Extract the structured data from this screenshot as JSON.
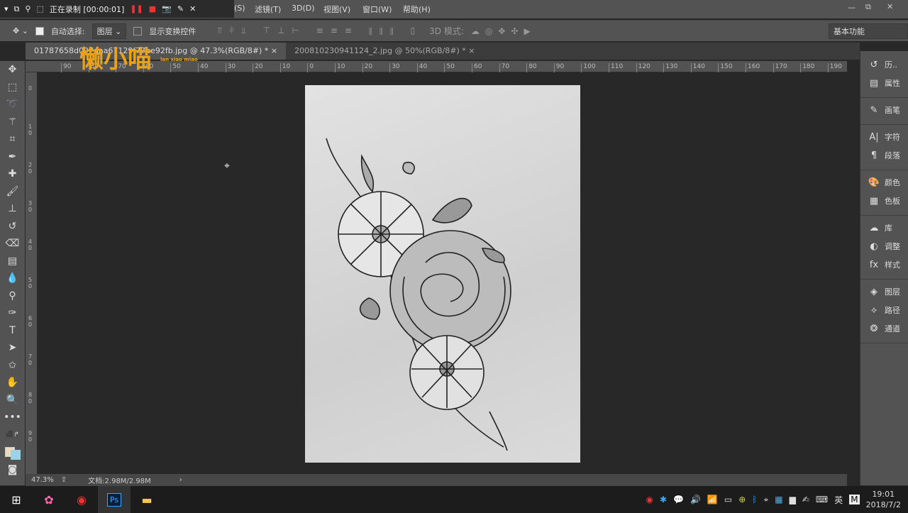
{
  "recorder": {
    "status": "正在录制 [00:00:01]"
  },
  "menus": [
    "(S)",
    "滤镜(T)",
    "3D(D)",
    "视图(V)",
    "窗口(W)",
    "帮助(H)"
  ],
  "options": {
    "auto_select_label": "自动选择:",
    "auto_select_checked": true,
    "layer_select": "图层",
    "show_transform_label": "显示变换控件",
    "show_transform_checked": false,
    "mode_3d_label": "3D 模式:",
    "workspace": "基本功能"
  },
  "tabs": [
    {
      "label": "01787658d097daa67129f77ee92fb.jpg @ 47.3%(RGB/8#) *",
      "active": true
    },
    {
      "label": "200810230941124_2.jpg @ 50%(RGB/8#) *",
      "active": false
    }
  ],
  "ruler_labels": [
    "90",
    "80",
    "70",
    "60",
    "50",
    "40",
    "30",
    "20",
    "10",
    "0",
    "10",
    "20",
    "30",
    "40",
    "50",
    "60",
    "70",
    "80",
    "90",
    "100",
    "110",
    "120",
    "130",
    "140",
    "150",
    "160",
    "170",
    "180",
    "190"
  ],
  "vruler_labels": [
    "0",
    "1 0",
    "2 0",
    "3 0",
    "4 0",
    "5 0",
    "6 0",
    "7 0",
    "8 0",
    "9 0"
  ],
  "watermark": {
    "text": "懒小喵",
    "sub": "lan xiao miao"
  },
  "panels": [
    {
      "icon": "history-icon",
      "label": "历.."
    },
    {
      "icon": "properties-icon",
      "label": "属性"
    },
    {
      "icon": "brush-icon",
      "label": "画笔"
    },
    {
      "icon": "character-icon",
      "label": "字符"
    },
    {
      "icon": "paragraph-icon",
      "label": "段落"
    },
    {
      "icon": "color-icon",
      "label": "颜色"
    },
    {
      "icon": "swatches-icon",
      "label": "色板"
    },
    {
      "icon": "libraries-icon",
      "label": "库"
    },
    {
      "icon": "adjustments-icon",
      "label": "调整"
    },
    {
      "icon": "styles-icon",
      "label": "样式"
    },
    {
      "icon": "layers-icon",
      "label": "图层"
    },
    {
      "icon": "paths-icon",
      "label": "路径"
    },
    {
      "icon": "channels-icon",
      "label": "通道"
    }
  ],
  "status": {
    "zoom": "47.3%",
    "doc": "文档:2.98M/2.98M"
  },
  "tray": {
    "lang": "英",
    "ime": "M",
    "time": "19:01",
    "date": "2018/7/2"
  }
}
